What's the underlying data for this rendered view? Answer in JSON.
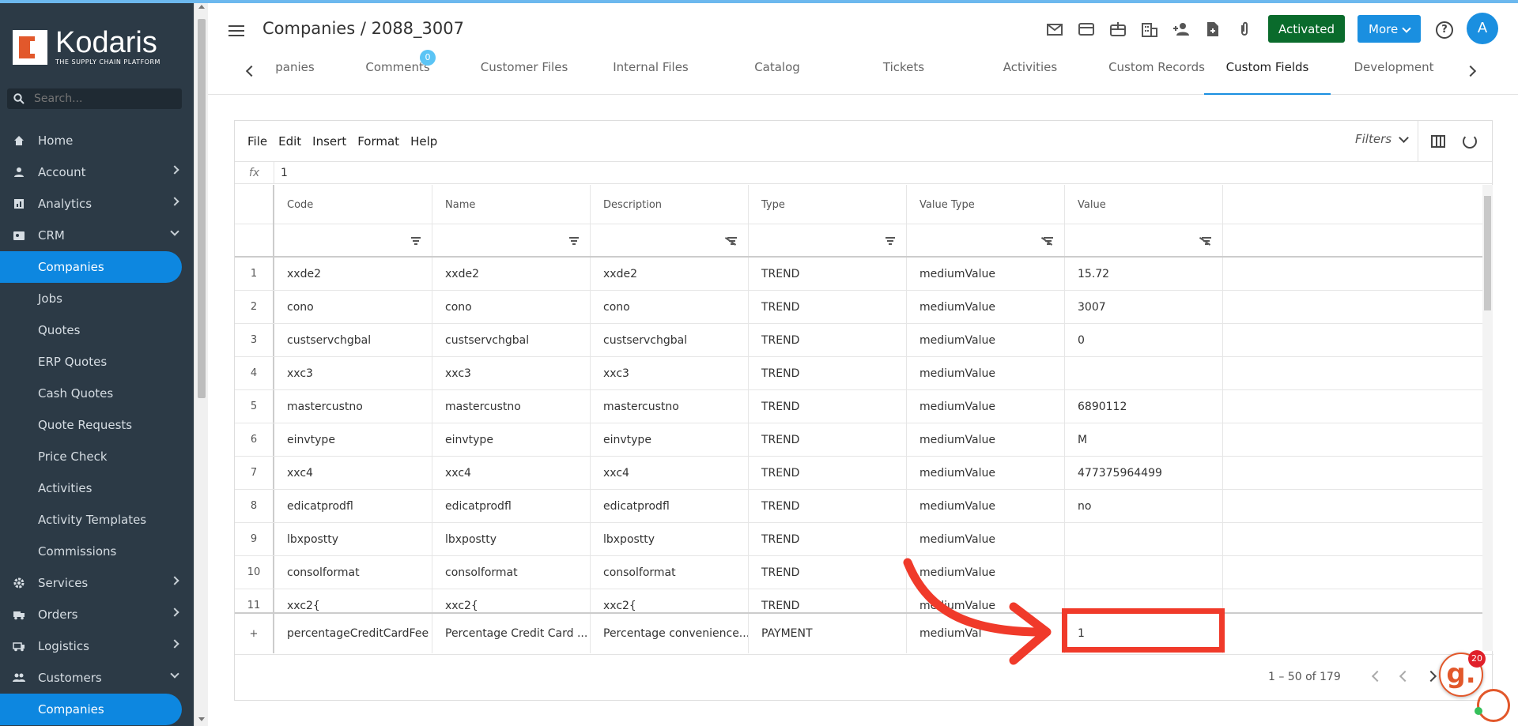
{
  "colors": {
    "sidebar_bg": "#2c3a46",
    "accent": "#1a8fe0",
    "activated": "#0a6b2c",
    "annotation": "#f03a2a"
  },
  "sidebar": {
    "logo_name": "Kodaris",
    "logo_tagline": "THE SUPPLY CHAIN PLATFORM",
    "search_placeholder": "Search...",
    "items": [
      {
        "label": "Home",
        "icon": "home-icon"
      },
      {
        "label": "Account",
        "icon": "person-icon"
      },
      {
        "label": "Analytics",
        "icon": "chart-icon"
      },
      {
        "label": "CRM",
        "icon": "contact-card-icon"
      },
      {
        "label": "Companies"
      },
      {
        "label": "Jobs"
      },
      {
        "label": "Quotes"
      },
      {
        "label": "ERP Quotes"
      },
      {
        "label": "Cash Quotes"
      },
      {
        "label": "Quote Requests"
      },
      {
        "label": "Price Check"
      },
      {
        "label": "Activities"
      },
      {
        "label": "Activity Templates"
      },
      {
        "label": "Commissions"
      },
      {
        "label": "Services",
        "icon": "gear-icon"
      },
      {
        "label": "Orders",
        "icon": "truck-icon"
      },
      {
        "label": "Logistics",
        "icon": "delivery-truck-icon"
      },
      {
        "label": "Customers",
        "icon": "people-icon"
      },
      {
        "label": "Companies"
      }
    ]
  },
  "header": {
    "title": "Companies / 2088_3007",
    "activated_label": "Activated",
    "more_label": "More",
    "avatar_initial": "A",
    "help_glyph": "?"
  },
  "tabs": [
    {
      "label": "panies"
    },
    {
      "label": "Comments",
      "badge": "0"
    },
    {
      "label": "Customer Files"
    },
    {
      "label": "Internal Files"
    },
    {
      "label": "Catalog"
    },
    {
      "label": "Tickets"
    },
    {
      "label": "Activities"
    },
    {
      "label": "Custom Records"
    },
    {
      "label": "Custom Fields"
    },
    {
      "label": "Development"
    }
  ],
  "grid": {
    "menu": [
      "File",
      "Edit",
      "Insert",
      "Format",
      "Help"
    ],
    "filters_label": "Filters",
    "fx_label": "fx",
    "fx_value": "1",
    "columns": [
      "Code",
      "Name",
      "Description",
      "Type",
      "Value Type",
      "Value"
    ],
    "rows": [
      [
        "1",
        "xxde2",
        "xxde2",
        "xxde2",
        "TREND",
        "mediumValue",
        "15.72"
      ],
      [
        "2",
        "cono",
        "cono",
        "cono",
        "TREND",
        "mediumValue",
        "3007"
      ],
      [
        "3",
        "custservchgbal",
        "custservchgbal",
        "custservchgbal",
        "TREND",
        "mediumValue",
        "0"
      ],
      [
        "4",
        "xxc3",
        "xxc3",
        "xxc3",
        "TREND",
        "mediumValue",
        ""
      ],
      [
        "5",
        "mastercustno",
        "mastercustno",
        "mastercustno",
        "TREND",
        "mediumValue",
        "6890112"
      ],
      [
        "6",
        "einvtype",
        "einvtype",
        "einvtype",
        "TREND",
        "mediumValue",
        "M"
      ],
      [
        "7",
        "xxc4",
        "xxc4",
        "xxc4",
        "TREND",
        "mediumValue",
        "477375964499"
      ],
      [
        "8",
        "edicatprodfl",
        "edicatprodfl",
        "edicatprodfl",
        "TREND",
        "mediumValue",
        "no"
      ],
      [
        "9",
        "lbxpostty",
        "lbxpostty",
        "lbxpostty",
        "TREND",
        "mediumValue",
        ""
      ],
      [
        "10",
        "consolformat",
        "consolformat",
        "consolformat",
        "TREND",
        "mediumValue",
        ""
      ],
      [
        "11",
        "xxc2{",
        "xxc2{",
        "xxc2{",
        "TREND",
        "mediumValue",
        ""
      ]
    ],
    "new_row": {
      "plus": "+",
      "code": "percentageCreditCardFee",
      "name": "Percentage Credit Card ...",
      "description": "Percentage convenience...",
      "type": "PAYMENT",
      "value_type": "mediumVal",
      "value": "1"
    },
    "pagination": "1 – 50 of 179"
  },
  "widget": {
    "help_glyph": "g.",
    "badge": "20"
  }
}
